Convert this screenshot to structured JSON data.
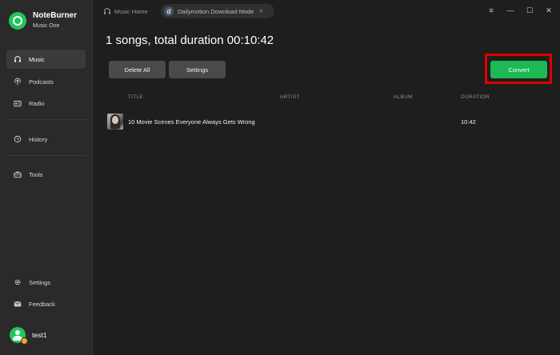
{
  "app": {
    "name": "NoteBurner",
    "subtitle": "Music One"
  },
  "sidebar": {
    "items": [
      {
        "label": "Music",
        "icon": "headphones-icon",
        "active": true
      },
      {
        "label": "Podcasts",
        "icon": "podcast-icon"
      },
      {
        "label": "Radio",
        "icon": "radio-icon"
      },
      {
        "label": "History",
        "icon": "history-icon"
      },
      {
        "label": "Tools",
        "icon": "toolbox-icon"
      },
      {
        "label": "Settings",
        "icon": "gear-icon"
      },
      {
        "label": "Feedback",
        "icon": "mail-icon"
      }
    ],
    "user": {
      "name": "test1"
    }
  },
  "topbar": {
    "home_tab": "Music Home",
    "active_tab": "Dailymotion Download Mode",
    "active_tab_icon_letter": "d",
    "window_controls": [
      "≡",
      "—",
      "☐",
      "✕"
    ]
  },
  "main": {
    "headline": "1 songs, total duration 00:10:42",
    "buttons": {
      "delete_all": "Delete All",
      "settings": "Settings",
      "convert": "Convert"
    },
    "table": {
      "columns": [
        "TITLE",
        "ARTIST",
        "ALBUM",
        "DURATION"
      ],
      "rows": [
        {
          "title": "10 Movie Scenes Everyone Always Gets Wrong",
          "artist": "",
          "album": "",
          "duration": "10:42"
        }
      ]
    }
  },
  "colors": {
    "accent": "#1db954",
    "highlight_box": "#e00000",
    "background": "#1e1e1e",
    "sidebar": "#2a2a2a"
  }
}
